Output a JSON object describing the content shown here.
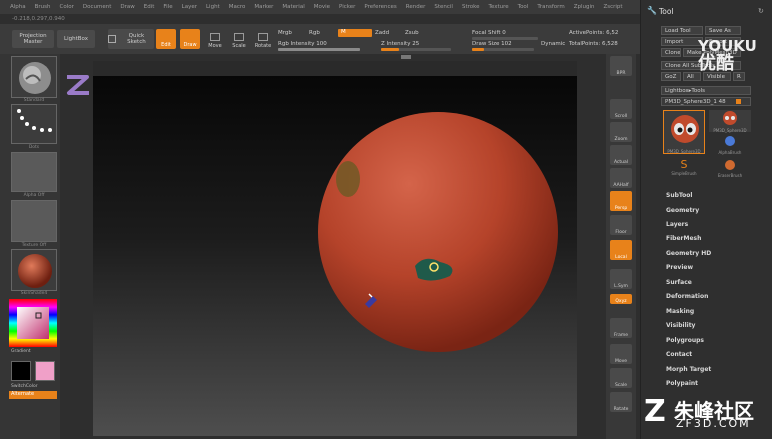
{
  "menu": [
    "Alpha",
    "Brush",
    "Color",
    "Document",
    "Draw",
    "Edit",
    "File",
    "Layer",
    "Light",
    "Macro",
    "Marker",
    "Material",
    "Movie",
    "Picker",
    "Preferences",
    "Render",
    "Stencil",
    "Stroke",
    "Texture",
    "Tool",
    "Transform",
    "Zplugin",
    "Zscript"
  ],
  "coords": "-0.218,0.297,0.940",
  "toolbar": {
    "projection_master": "Projection Master",
    "lightbox": "LightBox",
    "quick_sketch": "Quick Sketch",
    "edit": "Edit",
    "draw": "Draw",
    "move": "Move",
    "scale": "Scale",
    "rotate": "Rotate",
    "mrgb": "Mrgb",
    "rgb": "Rgb",
    "m": "M",
    "rgb_intensity_label": "Rgb Intensity",
    "rgb_intensity_value": "100",
    "rgb_intensity_fraction": 1.0,
    "zadd": "Zadd",
    "zsub": "Zsub",
    "z_intensity_label": "Z Intensity",
    "z_intensity_value": "25",
    "z_intensity_fraction": 0.25,
    "focal_shift_label": "Focal Shift",
    "focal_shift_value": "0",
    "draw_size_label": "Draw Size",
    "draw_size_value": "102",
    "draw_size_fraction": 0.2,
    "dynamic": "Dynamic",
    "active_points": "ActivePoints: 6,52",
    "total_points": "TotalPoints: 6,528"
  },
  "left_panel": {
    "captions": [
      "Standard",
      "Dots",
      "Alpha Off",
      "Texture Off",
      "SkinShade4",
      "Gradient",
      "SwitchColor",
      "Alternate"
    ]
  },
  "right_shelf": [
    "BPR",
    "Scroll",
    "Zoom",
    "Actual",
    "AAHalf",
    "Persp",
    "Floor",
    "Local",
    "L.Sym",
    "Qxyz",
    "Frame",
    "Move",
    "Scale",
    "Rotate"
  ],
  "tool_panel": {
    "title": "Tool",
    "buttons": [
      "Load Tool",
      "Save As",
      "Import",
      "Export",
      "Clone",
      "Make PolyMesh3D",
      "Clone All SubTools",
      "GoZ",
      "All",
      "Visible",
      "R",
      "Lightbox▸Tools"
    ],
    "current_tool": "PM3D_Sphere3D_1",
    "current_tool_value": "48",
    "thumbnails": [
      "PM3D_Sphere3D",
      "PM3D_Sphere3D",
      "AlphaBrush",
      "SimpleBrush",
      "EraserBrush"
    ],
    "sections": [
      "SubTool",
      "Geometry",
      "Layers",
      "FiberMesh",
      "Geometry HD",
      "Preview",
      "Surface",
      "Deformation",
      "Masking",
      "Visibility",
      "Polygroups",
      "Contact",
      "Morph Target",
      "Polypaint"
    ]
  },
  "watermarks": {
    "youku_en": "YOUKU",
    "youku_cn": "优酷",
    "zf_cn": "朱峰社区",
    "zf_en": "ZF3D.COM"
  },
  "colors": {
    "accent": "#e8821a",
    "sphere": "#c04a2c"
  }
}
